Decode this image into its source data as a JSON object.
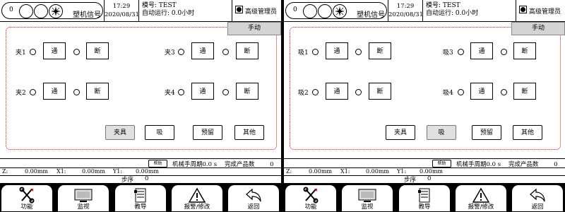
{
  "panels": [
    {
      "header": {
        "count": "0",
        "signal_label": "塑机信号",
        "time": "17:29",
        "date": "2020/08/31",
        "mold_label": "模号: TEST",
        "auto_run_label": "自动运行: 0.0小时",
        "user_level": "高级管理员"
      },
      "mode_tab": "手动",
      "rows": [
        {
          "label": "夹1",
          "on": "通",
          "off": "断"
        },
        {
          "label": "夹2",
          "on": "通",
          "off": "断"
        },
        {
          "label": "夹3",
          "on": "通",
          "off": "断"
        },
        {
          "label": "夹4",
          "on": "通",
          "off": "断"
        }
      ],
      "categories": [
        {
          "label": "夹具",
          "selected": true
        },
        {
          "label": "吸",
          "selected": false
        },
        {
          "label": "预留",
          "selected": false
        },
        {
          "label": "其他",
          "selected": false
        }
      ],
      "info": {
        "help": "帮助",
        "cycle": "机械手周期0.0 s",
        "done_label": "完成产品数",
        "done_value": "0",
        "z_label": "Z:",
        "z_value": "0.00mm",
        "x1_label": "X1:",
        "x1_value": "0.00mm",
        "y1_label": "Y1:",
        "y1_value": "0.00mm",
        "step_label": "步序",
        "step_value": "0"
      },
      "nav": [
        {
          "label": "功能",
          "icon": "tools-icon"
        },
        {
          "label": "监视",
          "icon": "monitor-icon"
        },
        {
          "label": "教导",
          "icon": "teach-icon"
        },
        {
          "label": "报警/修改",
          "icon": "alarm-icon"
        },
        {
          "label": "返回",
          "icon": "back-icon"
        }
      ]
    },
    {
      "header": {
        "count": "0",
        "signal_label": "塑机信号",
        "time": "17:29",
        "date": "2020/08/31",
        "mold_label": "模号: TEST",
        "auto_run_label": "自动运行: 0.0小时",
        "user_level": "高级管理员"
      },
      "mode_tab": "手动",
      "rows": [
        {
          "label": "吸1",
          "on": "通",
          "off": "断"
        },
        {
          "label": "吸2",
          "on": "通",
          "off": "断"
        },
        {
          "label": "吸3",
          "on": "通",
          "off": "断"
        },
        {
          "label": "吸4",
          "on": "通",
          "off": "断"
        }
      ],
      "categories": [
        {
          "label": "夹具",
          "selected": false
        },
        {
          "label": "吸",
          "selected": true
        },
        {
          "label": "预留",
          "selected": false
        },
        {
          "label": "其他",
          "selected": false
        }
      ],
      "info": {
        "help": "帮助",
        "cycle": "机械手周期0.0 s",
        "done_label": "完成产品数",
        "done_value": "0",
        "z_label": "Z:",
        "z_value": "0.00mm",
        "x1_label": "X1:",
        "x1_value": "0.00mm",
        "y1_label": "Y1:",
        "y1_value": "0.00mm",
        "step_label": "步序",
        "step_value": "0"
      },
      "nav": [
        {
          "label": "功能",
          "icon": "tools-icon"
        },
        {
          "label": "监视",
          "icon": "monitor-icon"
        },
        {
          "label": "教导",
          "icon": "teach-icon"
        },
        {
          "label": "报警/修改",
          "icon": "alarm-icon"
        },
        {
          "label": "返回",
          "icon": "back-icon"
        }
      ]
    }
  ]
}
